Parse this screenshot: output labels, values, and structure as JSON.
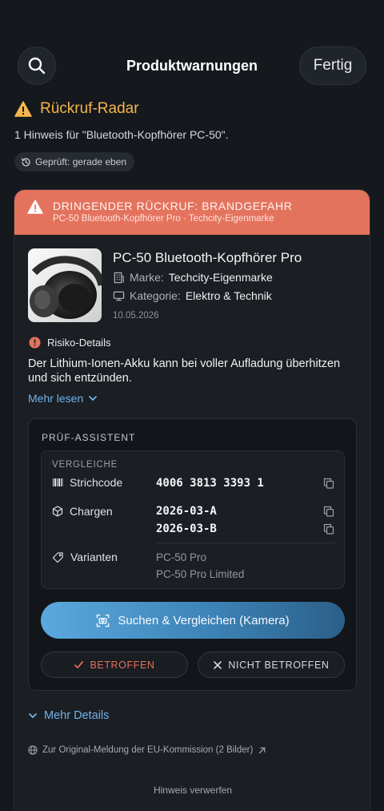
{
  "header": {
    "title": "Produktwarnungen",
    "done_label": "Fertig"
  },
  "radar": {
    "title": "Rückruf-Radar",
    "subtitle": "1 Hinweis für \"Bluetooth-Kopfhörer PC-50\".",
    "checked_label": "Geprüft: gerade eben"
  },
  "alert": {
    "banner_title": "DRINGENDER RÜCKRUF: BRANDGEFAHR",
    "banner_subtitle": "PC-50 Bluetooth-Kopfhörer Pro · Techcity-Eigenmarke",
    "product_name": "PC-50 Bluetooth-Kopfhörer Pro",
    "brand_label": "Marke:",
    "brand_value": "Techcity-Eigenmarke",
    "category_label": "Kategorie:",
    "category_value": "Elektro & Technik",
    "date": "10.05.2026",
    "risk_heading": "Risiko-Details",
    "risk_text": "Der Lithium-Ionen-Akku kann bei voller Aufladung überhitzen und sich entzünden.",
    "read_more": "Mehr lesen"
  },
  "assistant": {
    "title": "PRÜF-ASSISTENT",
    "compare_title": "VERGLEICHE",
    "barcode_label": "Strichcode",
    "barcode_value": "4006 3813 3393 1",
    "batches_label": "Chargen",
    "batches": [
      "2026-03-A",
      "2026-03-B"
    ],
    "variants_label": "Varianten",
    "variants": [
      "PC-50 Pro",
      "PC-50 Pro Limited"
    ],
    "search_button": "Suchen & Vergleichen (Kamera)",
    "affected_button": "BETROFFEN",
    "not_affected_button": "NICHT BETROFFEN"
  },
  "footer": {
    "more_details": "Mehr Details",
    "original_link": "Zur Original-Meldung der EU-Kommission (2 Bilder)",
    "dismiss": "Hinweis verwerfen"
  },
  "colors": {
    "background": "#15181d",
    "warning": "#f4b64c",
    "banner": "#e4735e",
    "link": "#6fb3ea",
    "affected": "#e66f5c"
  },
  "icons": [
    "search-icon",
    "warning-icon",
    "history-icon",
    "building-icon",
    "monitor-icon",
    "info-icon",
    "chevron-down-icon",
    "barcode-icon",
    "box-icon",
    "tag-icon",
    "copy-icon",
    "camera-scan-icon",
    "check-icon",
    "close-icon",
    "globe-icon",
    "external-link-icon"
  ]
}
